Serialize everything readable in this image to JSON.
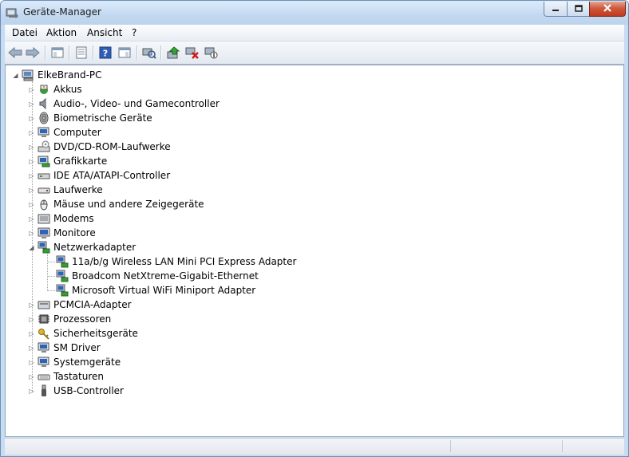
{
  "window": {
    "title": "Geräte-Manager"
  },
  "menu": {
    "items": [
      "Datei",
      "Aktion",
      "Ansicht",
      "?"
    ]
  },
  "toolbar": {
    "buttons": [
      {
        "icon": "back-arrow-icon"
      },
      {
        "icon": "forward-arrow-icon"
      },
      {
        "icon": "show-hide-console-tree-icon"
      },
      {
        "icon": "properties-icon"
      },
      {
        "icon": "help-icon"
      },
      {
        "icon": "show-action-pane-icon"
      },
      {
        "icon": "scan-hardware-icon"
      },
      {
        "icon": "update-driver-icon"
      },
      {
        "icon": "uninstall-device-icon"
      },
      {
        "icon": "disable-device-icon"
      }
    ]
  },
  "tree": {
    "root": {
      "label": "ElkeBrand-PC",
      "expanded": true
    },
    "categories": [
      {
        "label": "Akkus",
        "icon": "battery-icon"
      },
      {
        "label": "Audio-, Video- und Gamecontroller",
        "icon": "speaker-icon"
      },
      {
        "label": "Biometrische Geräte",
        "icon": "fingerprint-icon"
      },
      {
        "label": "Computer",
        "icon": "computer-icon"
      },
      {
        "label": "DVD/CD-ROM-Laufwerke",
        "icon": "dvd-drive-icon"
      },
      {
        "label": "Grafikkarte",
        "icon": "display-adapter-icon"
      },
      {
        "label": "IDE ATA/ATAPI-Controller",
        "icon": "ide-controller-icon"
      },
      {
        "label": "Laufwerke",
        "icon": "disk-drive-icon"
      },
      {
        "label": "Mäuse und andere Zeigegeräte",
        "icon": "mouse-icon"
      },
      {
        "label": "Modems",
        "icon": "modem-icon"
      },
      {
        "label": "Monitore",
        "icon": "monitor-icon"
      },
      {
        "label": "Netzwerkadapter",
        "icon": "network-adapter-icon",
        "expanded": true,
        "children": [
          {
            "label": "11a/b/g Wireless LAN Mini PCI Express Adapter",
            "icon": "network-adapter-icon"
          },
          {
            "label": "Broadcom NetXtreme-Gigabit-Ethernet",
            "icon": "network-adapter-icon"
          },
          {
            "label": "Microsoft Virtual WiFi Miniport Adapter",
            "icon": "network-adapter-icon"
          }
        ]
      },
      {
        "label": "PCMCIA-Adapter",
        "icon": "pcmcia-icon"
      },
      {
        "label": "Prozessoren",
        "icon": "processor-icon"
      },
      {
        "label": "Sicherheitsgeräte",
        "icon": "security-key-icon"
      },
      {
        "label": "SM Driver",
        "icon": "computer-icon"
      },
      {
        "label": "Systemgeräte",
        "icon": "system-device-icon"
      },
      {
        "label": "Tastaturen",
        "icon": "keyboard-icon"
      },
      {
        "label": "USB-Controller",
        "icon": "usb-icon"
      }
    ]
  },
  "colors": {
    "accent": "#c5dcf2",
    "close": "#c1381c"
  }
}
